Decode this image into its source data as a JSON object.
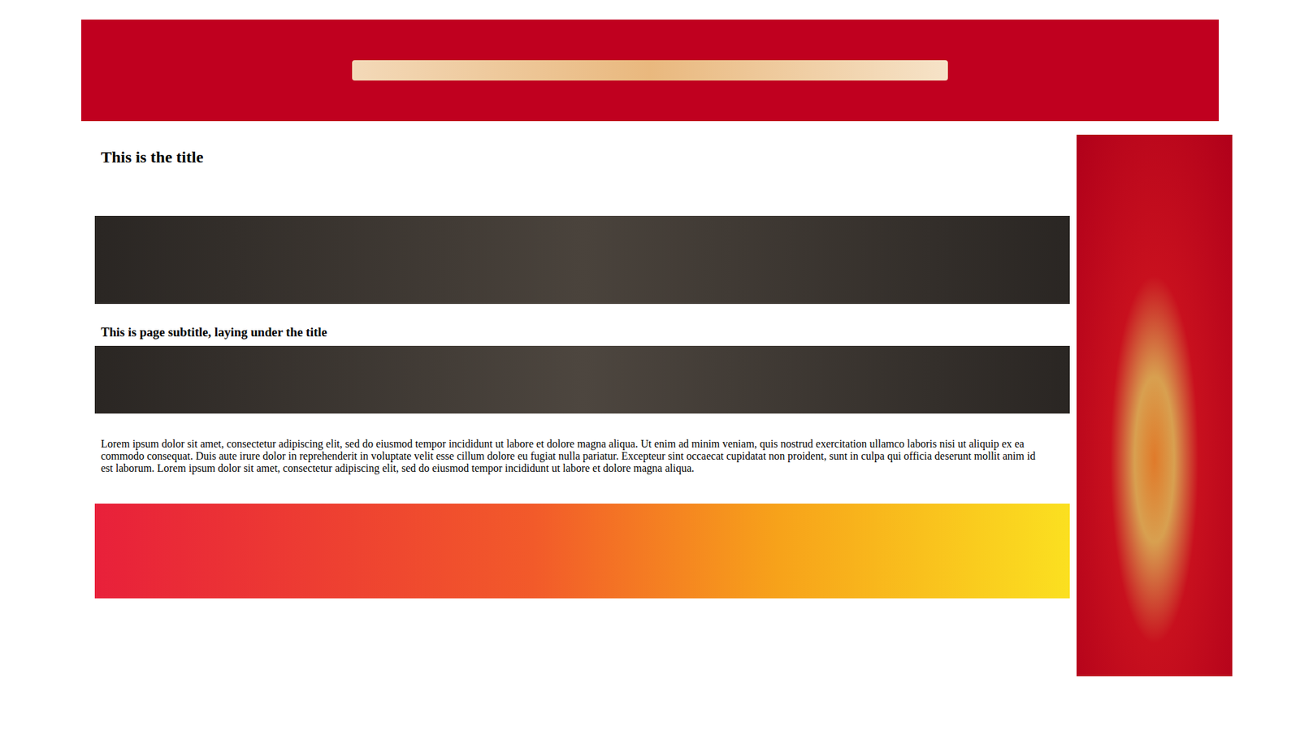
{
  "page": {
    "title": "This is the title",
    "subtitle": "This is page subtitle, laying under the title",
    "body": "Lorem ipsum dolor sit amet, consectetur adipiscing elit, sed do eiusmod tempor incididunt ut labore et dolore magna aliqua. Ut enim ad minim veniam, quis nostrud exercitation ullamco laboris nisi ut aliquip ex ea commodo consequat. Duis aute irure dolor in reprehenderit in voluptate velit esse cillum dolore eu fugiat nulla pariatur. Excepteur sint occaecat cupidatat non proident, sunt in culpa qui officia deserunt mollit anim id est laborum. Lorem ipsum dolor sit amet, consectetur adipiscing elit, sed do eiusmod tempor incididunt ut labore et dolore magna aliqua."
  }
}
